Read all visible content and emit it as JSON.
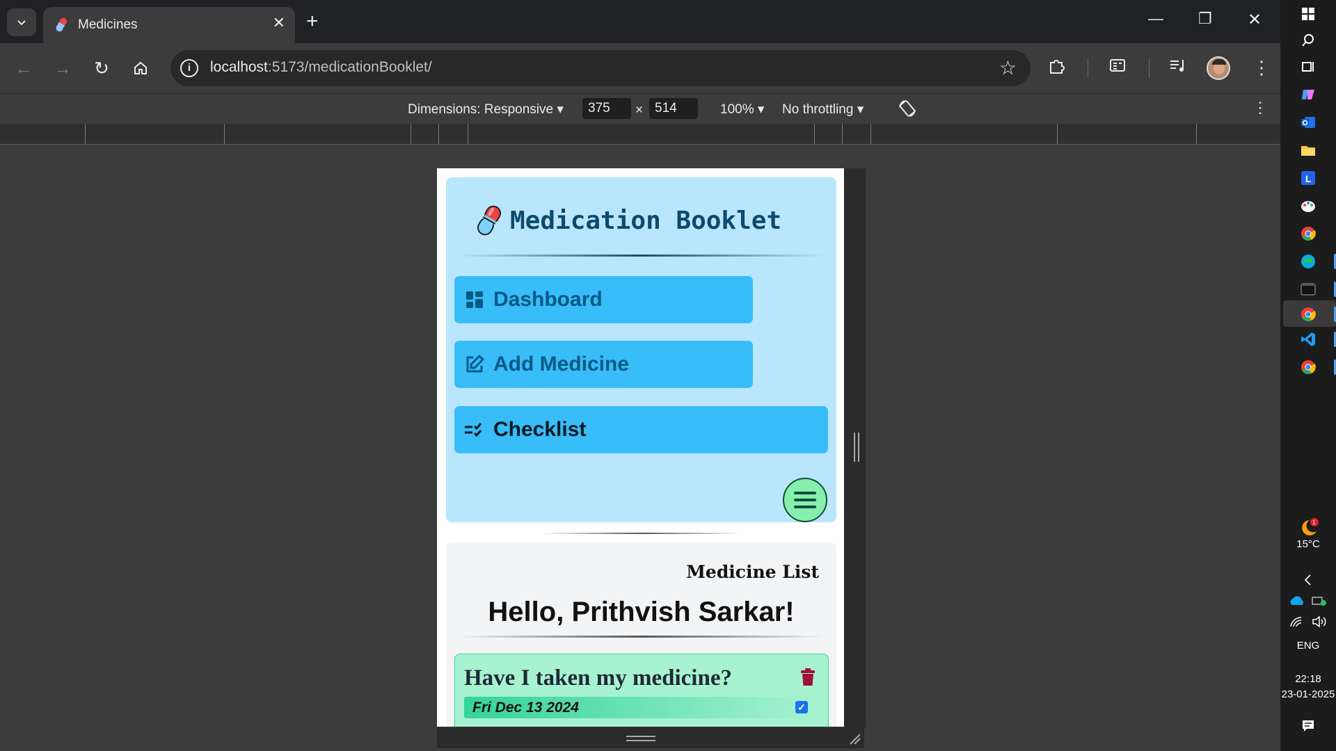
{
  "browser": {
    "tab_title": "Medicines",
    "url_host": "localhost",
    "url_path": ":5173/medicationBooklet/"
  },
  "devtools": {
    "dimensions_label": "Dimensions: Responsive",
    "width": "375",
    "times": "×",
    "height": "514",
    "zoom": "100%",
    "throttling": "No throttling"
  },
  "app": {
    "brand_title": "Medication Booklet",
    "nav": {
      "dashboard": "Dashboard",
      "add_medicine": "Add Medicine",
      "checklist": "Checklist"
    },
    "list_heading": "Medicine List",
    "greeting": "Hello, Prithvish Sarkar!",
    "card": {
      "question": "Have I taken my medicine?",
      "date": "Fri Dec 13 2024",
      "checked": true
    },
    "colors": {
      "header_bg": "#bae6fd",
      "nav_button": "#38bdf8",
      "nav_text": "#075985",
      "card_bg": "#a7f3d0",
      "fab": "#86efac"
    }
  },
  "taskbar": {
    "weather_temp": "15°C",
    "weather_badge": "1",
    "language": "ENG",
    "time": "22:18",
    "date": "23-01-2025"
  }
}
